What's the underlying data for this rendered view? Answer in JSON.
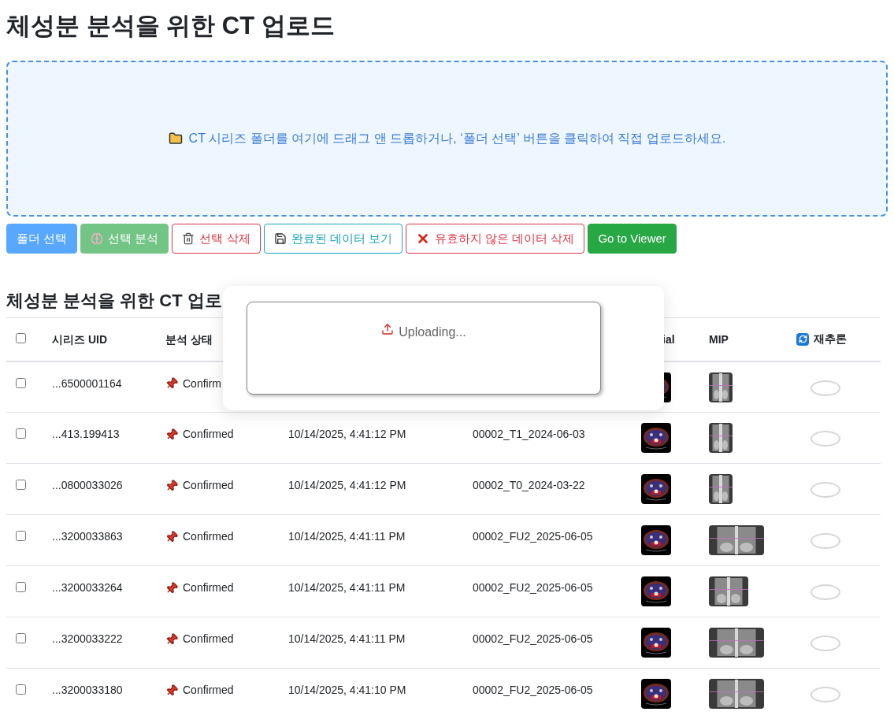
{
  "title": "체성분 분석을 위한 CT 업로드",
  "dropzone": {
    "text": "CT 시리즈 폴더를 여기에 드래그 앤 드롭하거나, ‘폴더 선택’ 버튼을 클릭하여 직접 업로드하세요."
  },
  "buttons": [
    {
      "label": "폴더 선택",
      "kind": "primary",
      "disabled": true
    },
    {
      "label": "선택 분석",
      "kind": "success",
      "disabled": true
    },
    {
      "label": "선택 삭제",
      "kind": "outline-danger",
      "disabled": false
    },
    {
      "label": "완료된 데이터 보기",
      "kind": "outline-info",
      "disabled": false
    },
    {
      "label": "유효하지 않은 데이터 삭제",
      "kind": "outline-danger",
      "disabled": false
    },
    {
      "label": "Go to Viewer",
      "kind": "success",
      "disabled": false
    }
  ],
  "section_title": "체성분 분석을 위한 CT 업로",
  "table": {
    "header": {
      "checked": false,
      "uid": "시리즈 UID",
      "status": "분석 상태",
      "axial": "ial",
      "mip": "MIP",
      "reinfer": "재추론"
    },
    "rows": [
      {
        "checked": false,
        "uid": "...6500001164",
        "status": "Confirm"
      },
      {
        "checked": false,
        "uid": "...413.199413",
        "status": "Confirmed",
        "date": "10/14/2025, 4:41:12 PM",
        "name": "00002_T1_2024-06-03"
      },
      {
        "checked": false,
        "uid": "...0800033026",
        "status": "Confirmed",
        "date": "10/14/2025, 4:41:12 PM",
        "name": "00002_T0_2024-03-22"
      },
      {
        "checked": false,
        "uid": "...3200033863",
        "status": "Confirmed",
        "date": "10/14/2025, 4:41:11 PM",
        "name": "00002_FU2_2025-06-05"
      },
      {
        "checked": false,
        "uid": "...3200033264",
        "status": "Confirmed",
        "date": "10/14/2025, 4:41:11 PM",
        "name": "00002_FU2_2025-06-05"
      },
      {
        "checked": false,
        "uid": "...3200033222",
        "status": "Confirmed",
        "date": "10/14/2025, 4:41:11 PM",
        "name": "00002_FU2_2025-06-05"
      },
      {
        "checked": false,
        "uid": "...3200033180",
        "status": "Confirmed",
        "date": "10/14/2025, 4:41:10 PM",
        "name": "00002_FU2_2025-06-05"
      }
    ]
  },
  "modal": {
    "text": "Uploading..."
  }
}
